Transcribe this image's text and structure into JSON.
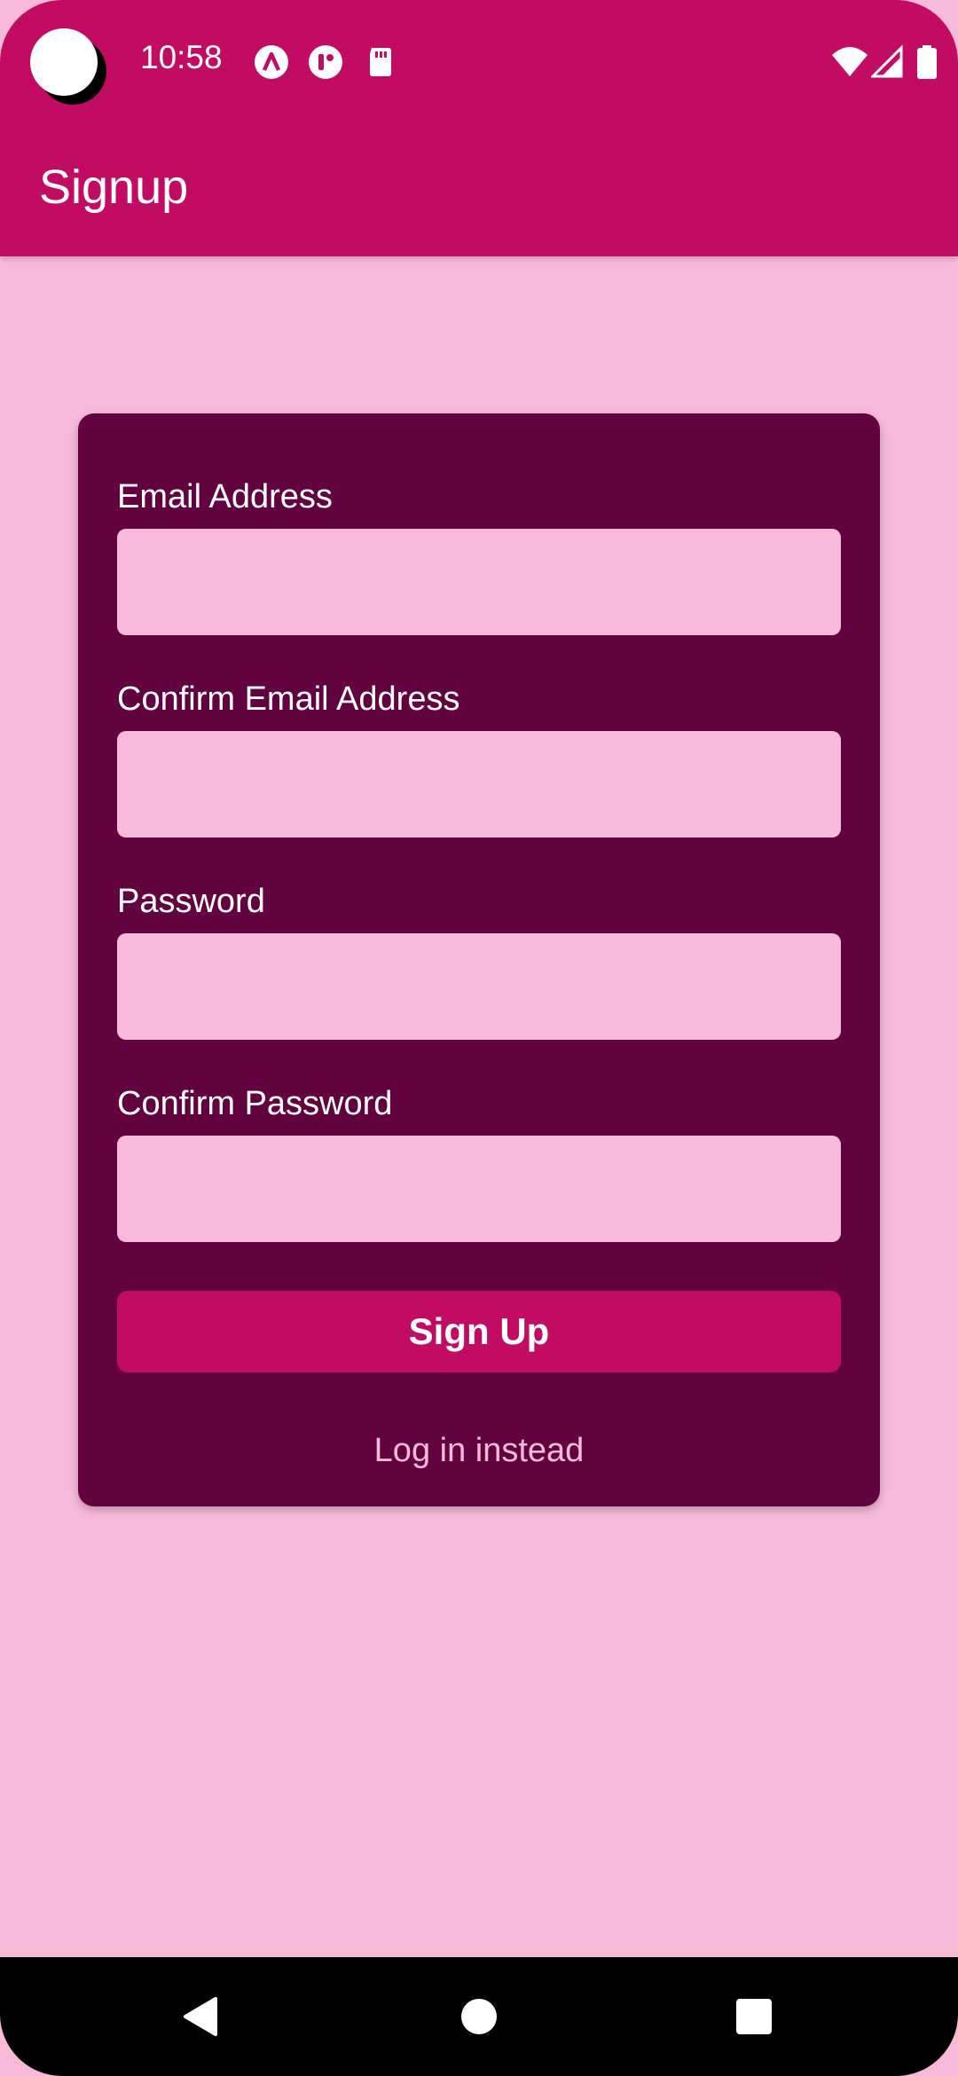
{
  "status_bar": {
    "time": "10:58",
    "left_icons": [
      "camera-cutout",
      "app-notification-icon",
      "app-notification-icon-2",
      "sd-card-icon"
    ],
    "right_icons": [
      "wifi-icon",
      "cell-signal-icon",
      "battery-icon"
    ]
  },
  "app_bar": {
    "title": "Signup"
  },
  "form": {
    "email_label": "Email Address",
    "email_value": "",
    "confirm_email_label": "Confirm Email Address",
    "confirm_email_value": "",
    "password_label": "Password",
    "password_value": "",
    "confirm_password_label": "Confirm Password",
    "confirm_password_value": "",
    "signup_button": "Sign Up",
    "login_link": "Log in instead"
  },
  "nav_bar": {
    "buttons": [
      "back-icon",
      "home-icon",
      "recents-icon"
    ]
  },
  "colors": {
    "primary": "#c20b62",
    "background": "#f7bbd9",
    "card": "#62033f",
    "text_on_dark": "#ffffff"
  }
}
